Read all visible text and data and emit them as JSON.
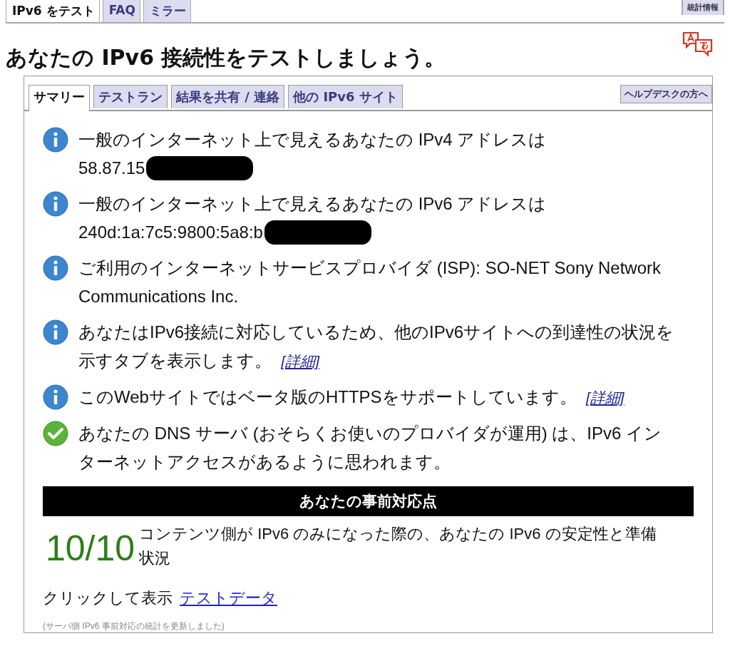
{
  "top_tabs": [
    {
      "label": "IPv6 をテスト",
      "selected": true
    },
    {
      "label": "FAQ",
      "selected": false
    },
    {
      "label": "ミラー",
      "selected": false
    }
  ],
  "stats_button": "統計情報",
  "heading": "あなたの IPv6 接続性をテストしましょう。",
  "tabs": [
    {
      "label": "サマリー",
      "selected": true
    },
    {
      "label": "テストラン",
      "selected": false
    },
    {
      "label": "結果を共有 / 連絡",
      "selected": false
    },
    {
      "label": "他の IPv6 サイト",
      "selected": false
    }
  ],
  "helpdesk_button": "ヘルプデスクの方へ",
  "messages": [
    {
      "kind": "info",
      "text": "一般のインターネット上で見えるあなたの IPv4 アドレスは",
      "value": "58.87.15",
      "redacted": true
    },
    {
      "kind": "info",
      "text": "一般のインターネット上で見えるあなたの IPv6 アドレスは",
      "value": "240d:1a:7c5:9800:5a8:b",
      "redacted": true
    },
    {
      "kind": "info",
      "text": "ご利用のインターネットサービスプロバイダ (ISP): SO-NET Sony Network Communications Inc."
    },
    {
      "kind": "info",
      "text": "あなたはIPv6接続に対応しているため、他のIPv6サイトへの到達性の状況を示すタブを表示します。",
      "link": "[詳細]"
    },
    {
      "kind": "info",
      "text": "このWebサイトではベータ版のHTTPSをサポートしています。",
      "link": "[詳細]"
    },
    {
      "kind": "ok",
      "text": "あなたの DNS サーバ (おそらくお使いのプロバイダが運用) は、IPv6 インターネットアクセスがあるように思われます。"
    }
  ],
  "readiness": {
    "title": "あなたの事前対応点",
    "score": "10/10",
    "description": "コンテンツ側が IPv6 のみになった際の、あなたの IPv6 の安定性と準備状況"
  },
  "show_data": {
    "label": "クリックして表示",
    "link": "テストデータ"
  },
  "footnote": "(サーバ側 IPv6 事前対応の統計を更新しました)"
}
